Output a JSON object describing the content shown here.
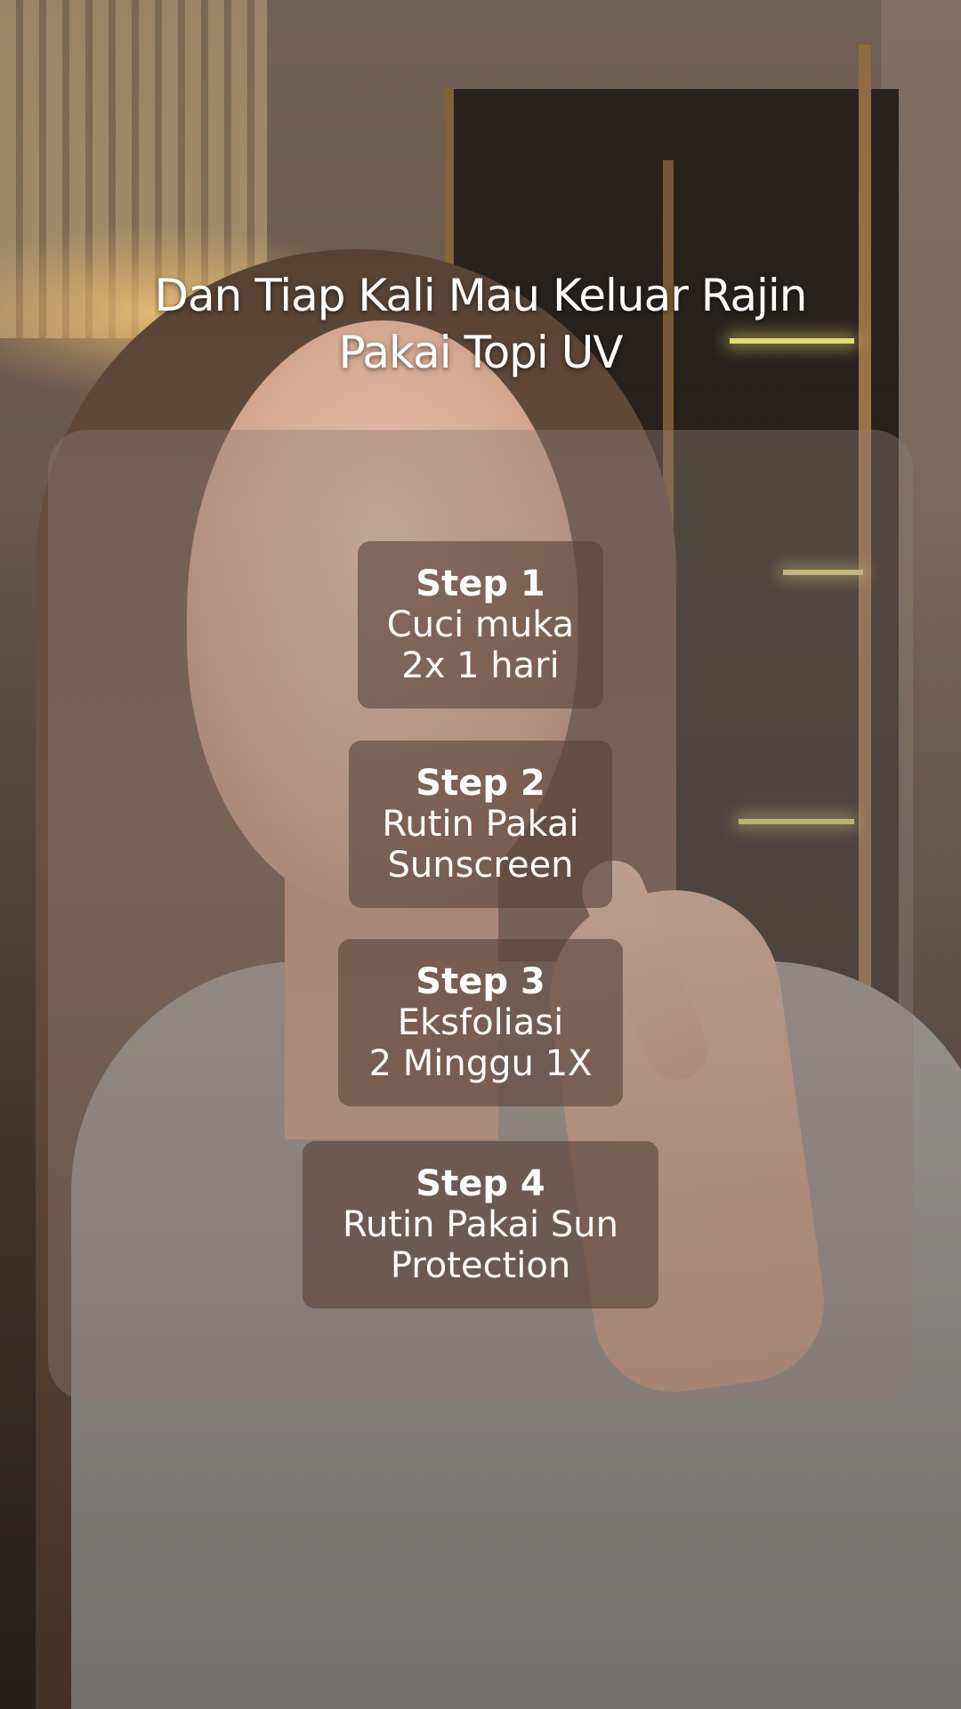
{
  "headline": {
    "line1": "Dan Tiap Kali Mau Keluar Rajin",
    "line2": "Pakai Topi UV"
  },
  "steps": [
    {
      "title": "Step 1",
      "line1": "Cuci muka",
      "line2": "2x 1 hari"
    },
    {
      "title": "Step 2",
      "line1": "Rutin Pakai",
      "line2": "Sunscreen"
    },
    {
      "title": "Step 3",
      "line1": "Eksfoliasi",
      "line2": "2 Minggu 1X"
    },
    {
      "title": "Step 4",
      "line1": "Rutin Pakai Sun",
      "line2": "Protection"
    }
  ],
  "colors": {
    "text": "#ffffff",
    "panel": "#8c7c74",
    "card": "#58423a"
  }
}
